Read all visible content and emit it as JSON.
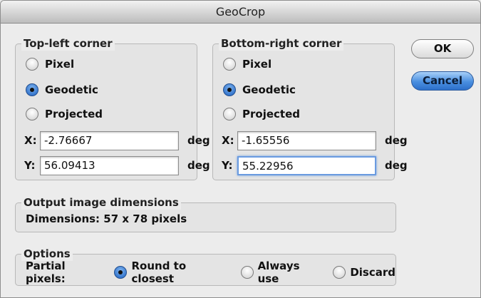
{
  "window": {
    "title": "GeoCrop"
  },
  "top_left": {
    "legend": "Top-left corner",
    "options": [
      "Pixel",
      "Geodetic",
      "Projected"
    ],
    "selected": "Geodetic",
    "x_label": "X:",
    "x_value": "-2.76667",
    "x_unit": "deg",
    "y_label": "Y:",
    "y_value": "56.09413",
    "y_unit": "deg"
  },
  "bottom_right": {
    "legend": "Bottom-right corner",
    "options": [
      "Pixel",
      "Geodetic",
      "Projected"
    ],
    "selected": "Geodetic",
    "x_label": "X:",
    "x_value": "-1.65556",
    "x_unit": "deg",
    "y_label": "Y:",
    "y_value": "55.22956",
    "y_unit": "deg"
  },
  "output": {
    "legend": "Output image dimensions",
    "dimensions_text": "Dimensions: 57 x 78 pixels"
  },
  "options": {
    "legend": "Options",
    "partial_label": "Partial pixels:",
    "choices": [
      "Round to closest",
      "Always use",
      "Discard"
    ],
    "selected": "Round to closest"
  },
  "buttons": {
    "ok": "OK",
    "cancel": "Cancel"
  }
}
